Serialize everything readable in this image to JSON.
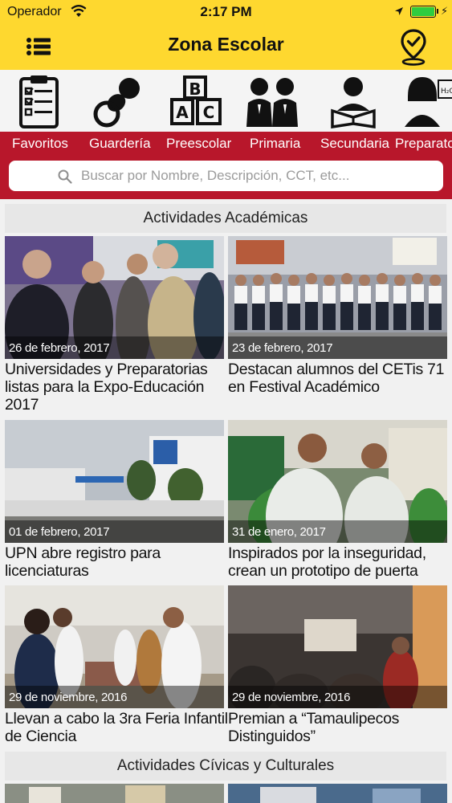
{
  "status_bar": {
    "carrier": "Operador",
    "time": "2:17 PM",
    "wifi_icon": "wifi-icon",
    "location_icon": "location-arrow-icon",
    "battery_icon": "battery-icon",
    "charging_icon": "bolt-icon"
  },
  "nav": {
    "title": "Zona Escolar",
    "menu_icon": "list-menu-icon",
    "location_pin_icon": "map-pin-check-icon"
  },
  "categories": [
    {
      "label": "Favoritos",
      "icon": "clipboard-checklist-icon"
    },
    {
      "label": "Guardería",
      "icon": "pacifier-icon"
    },
    {
      "label": "Preescolar",
      "icon": "abc-blocks-icon"
    },
    {
      "label": "Primaria",
      "icon": "kids-icon"
    },
    {
      "label": "Secundaria",
      "icon": "student-reading-icon"
    },
    {
      "label": "Preparatoria",
      "icon": "chemistry-student-icon"
    }
  ],
  "search": {
    "placeholder": "Buscar por Nombre, Descripción, CCT, etc...",
    "icon": "search-icon"
  },
  "sections": [
    {
      "title": "Actividades Académicas",
      "cards": [
        {
          "date": "26 de febrero, 2017",
          "headline": "Universidades y Preparatorias listas para la Expo-Educación 2017"
        },
        {
          "date": "23 de febrero, 2017",
          "headline": "Destacan alumnos del CETis 71 en Festival Académico"
        },
        {
          "date": "01 de febrero, 2017",
          "headline": "UPN abre registro para licenciaturas"
        },
        {
          "date": "31 de enero, 2017",
          "headline": "Inspirados por la inseguridad, crean un prototipo de puerta"
        },
        {
          "date": "29 de noviembre, 2016",
          "headline": "Llevan a cabo la 3ra Feria Infantil de Ciencia"
        },
        {
          "date": "29 de noviembre, 2016",
          "headline": "Premian a “Tamaulipecos Distinguidos”"
        }
      ]
    },
    {
      "title": "Actividades Cívicas y Culturales",
      "cards": []
    }
  ],
  "colors": {
    "header_yellow": "#fed82f",
    "category_red": "#b8172b",
    "content_bg": "#f1f1f1"
  }
}
